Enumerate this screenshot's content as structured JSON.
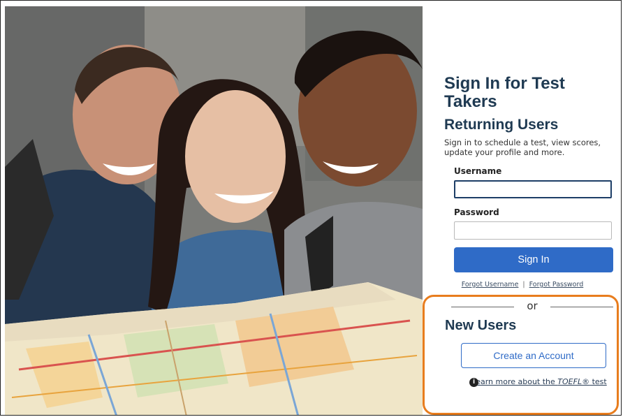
{
  "signin": {
    "title": "Sign In for Test Takers",
    "section": "Returning Users",
    "intro": "Sign in to schedule a test, view scores, update your profile and more.",
    "username_label": "Username",
    "username_value": "",
    "password_label": "Password",
    "password_value": "",
    "button": "Sign In",
    "forgot_username": "Forgot Username",
    "forgot_separator": "|",
    "forgot_password": "Forgot Password"
  },
  "newusers": {
    "or": "or",
    "heading": "New Users",
    "create_button": "Create an Account",
    "learn_prefix": "Learn more about the ",
    "learn_emph": "TOEFL®",
    "learn_suffix": " test"
  },
  "colors": {
    "primary": "#2f6bc7",
    "heading": "#1f3a52",
    "highlight_border": "#e87d1e"
  },
  "icons": {
    "info": "info-circle-icon"
  }
}
